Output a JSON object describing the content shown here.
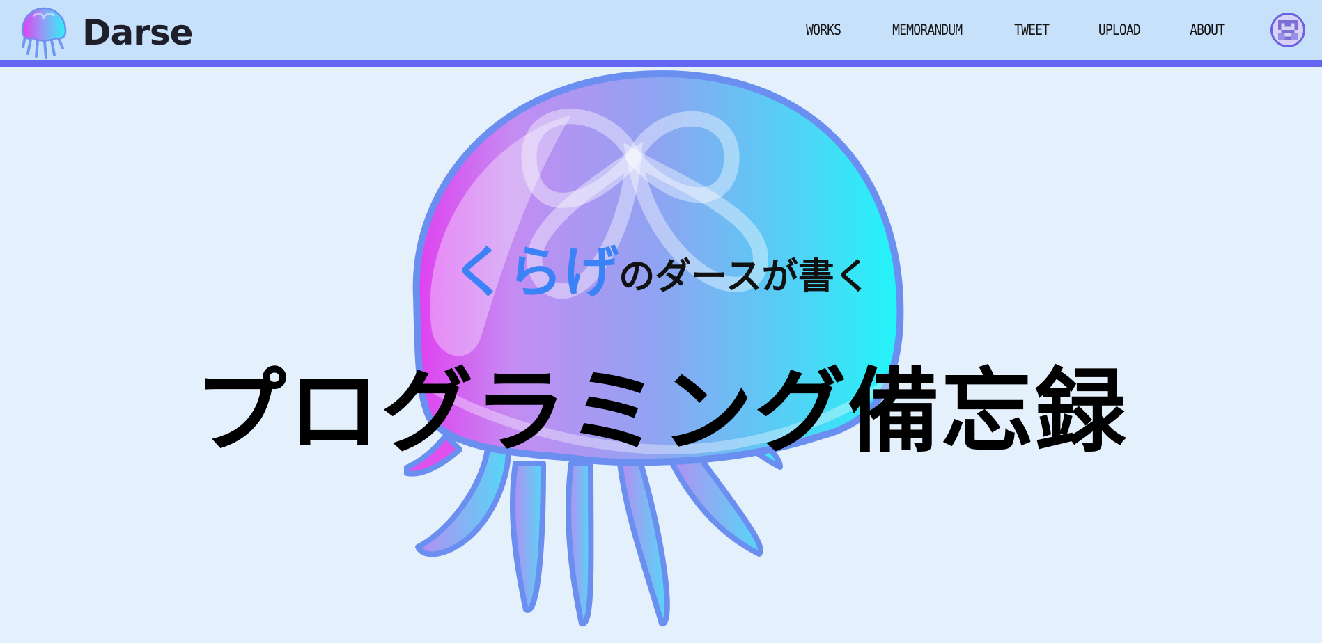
{
  "header": {
    "logo_text": "Darse",
    "nav": [
      {
        "label": "WORKS"
      },
      {
        "label": "MEMORANDUM"
      },
      {
        "label": "TWEET"
      },
      {
        "label": "UPLOAD"
      },
      {
        "label": "ABOUT"
      }
    ],
    "avatar_icon": "pixel-avatar-icon"
  },
  "hero": {
    "subtitle_accent": "くらげ",
    "subtitle_rest": "のダースが書く",
    "title": "プログラミング備忘録"
  },
  "colors": {
    "header_bg": "#c8e1fb",
    "header_border": "#6366f1",
    "page_bg": "#e4f0fc",
    "accent": "#3b82f6",
    "jelly_magenta": "#e040f0",
    "jelly_cyan": "#22f5f8"
  }
}
